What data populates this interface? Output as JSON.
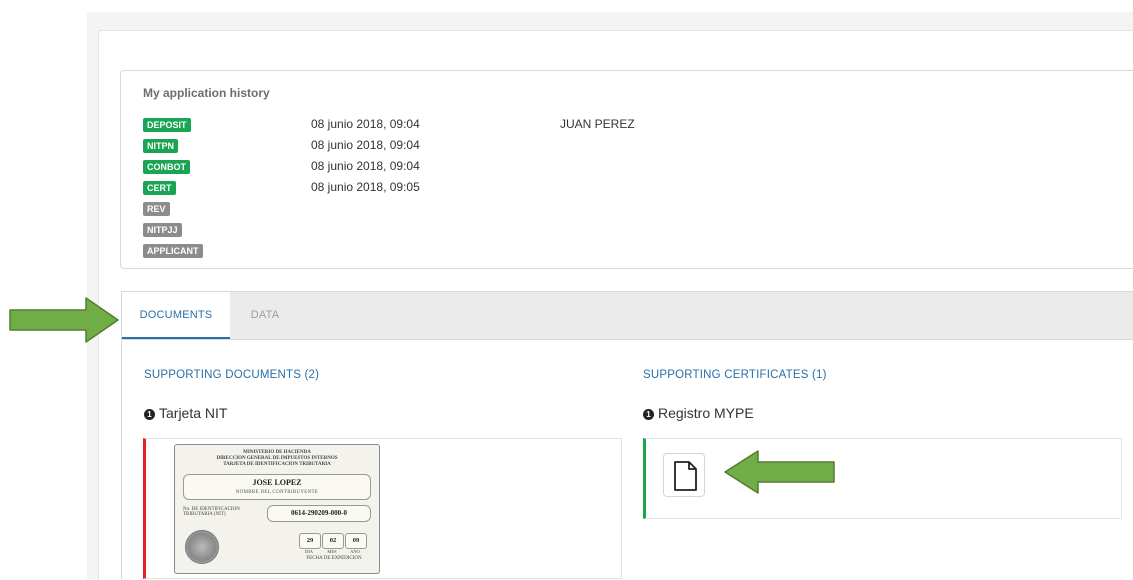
{
  "history": {
    "title": "My application history",
    "rows": [
      {
        "badge": "DEPOSIT",
        "status": "green",
        "date": "08 junio 2018, 09:04",
        "user": "JUAN PEREZ"
      },
      {
        "badge": "NITPN",
        "status": "green",
        "date": "08 junio 2018, 09:04",
        "user": ""
      },
      {
        "badge": "CONBOT",
        "status": "green",
        "date": "08 junio 2018, 09:04",
        "user": ""
      },
      {
        "badge": "CERT",
        "status": "green",
        "date": "08 junio 2018, 09:05",
        "user": ""
      },
      {
        "badge": "REV",
        "status": "gray",
        "date": "",
        "user": ""
      },
      {
        "badge": "NITPJJ",
        "status": "gray",
        "date": "",
        "user": ""
      },
      {
        "badge": "APPLICANT",
        "status": "gray",
        "date": "",
        "user": ""
      }
    ]
  },
  "tabs": [
    {
      "label": "DOCUMENTS",
      "active": true
    },
    {
      "label": "DATA",
      "active": false
    }
  ],
  "documents": {
    "supporting_documents": {
      "title": "SUPPORTING DOCUMENTS (2)",
      "item": {
        "number": "1",
        "name": "Tarjeta NIT"
      }
    },
    "supporting_certificates": {
      "title": "SUPPORTING CERTIFICATES (1)",
      "item": {
        "number": "1",
        "name": "Registro MYPE"
      }
    }
  },
  "id_card": {
    "header_1": "MINISTERIO DE HACIENDA",
    "header_2": "DIRECCION GENERAL DE IMPUESTOS INTERNOS",
    "header_3": "TARJETA DE IDENTIFICACION TRIBUTARIA",
    "holder_name": "JOSE LOPEZ",
    "holder_label": "NOMBRE DEL CONTRIBUYENTE",
    "nit_label": "No. DE IDENTIFICACION TRIBUTARIA (NIT)",
    "nit_number": "0614-290209-000-0",
    "day": "29",
    "month": "02",
    "year": "09",
    "day_label": "DIA",
    "month_label": "MES",
    "year_label": "AÑO",
    "date_label": "FECHA DE EXPEDICION"
  },
  "colors": {
    "accent": "#2a6ea6",
    "badge_done": "#1aa553",
    "badge_pending": "#8c8c8c",
    "doc_border": "#e02424",
    "cert_border": "#1aa553",
    "annotation_arrow": "#70ad47"
  },
  "icons": {
    "file": "file-icon",
    "number": "number-circle-icon",
    "arrow": "arrow-right-icon"
  }
}
